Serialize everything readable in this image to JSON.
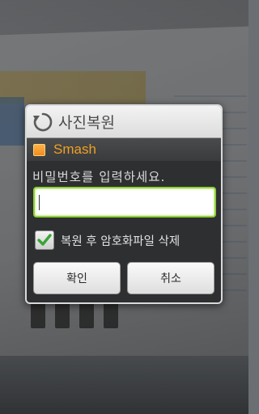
{
  "dialog": {
    "title": "사진복원",
    "title_icon": "restore-icon",
    "app_icon": "app-square-icon",
    "app_name": "Smash",
    "prompt": "비밀번호를 입력하세요.",
    "password": {
      "value": "",
      "placeholder": ""
    },
    "checkbox": {
      "label": "복원 후 암호화파일 삭제",
      "checked": true
    },
    "buttons": {
      "ok": "확인",
      "cancel": "취소"
    }
  },
  "colors": {
    "accent": "#f0a020",
    "input_focus": "#8dcf3a",
    "check_green": "#39a534"
  }
}
